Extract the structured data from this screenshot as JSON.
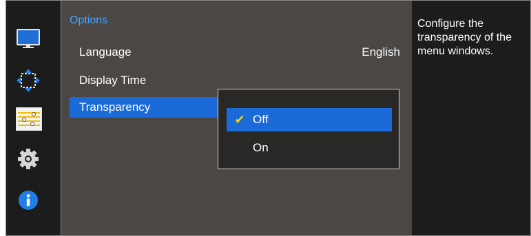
{
  "sidebar": {
    "items": [
      {
        "icon": "monitor-icon",
        "active": false
      },
      {
        "icon": "position-arrows-icon",
        "active": false
      },
      {
        "icon": "options-sliders-icon",
        "active": true
      },
      {
        "icon": "gear-icon",
        "active": false
      },
      {
        "icon": "info-icon",
        "active": false
      }
    ]
  },
  "main": {
    "title": "Options",
    "rows": [
      {
        "label": "Language",
        "value": "English"
      },
      {
        "label": "Display Time",
        "value": ""
      },
      {
        "label": "Transparency",
        "value": ""
      }
    ],
    "selected_row": "Transparency"
  },
  "popup": {
    "options": [
      {
        "label": "Off",
        "checked": true
      },
      {
        "label": "On",
        "checked": false
      }
    ]
  },
  "description": {
    "text": "Configure the transparency of the menu windows."
  },
  "colors": {
    "accent": "#1a6ad8",
    "title": "#4aa3ff",
    "check": "#ffd200",
    "panel": "#4a4744",
    "sidebar": "#1c1c1c"
  }
}
